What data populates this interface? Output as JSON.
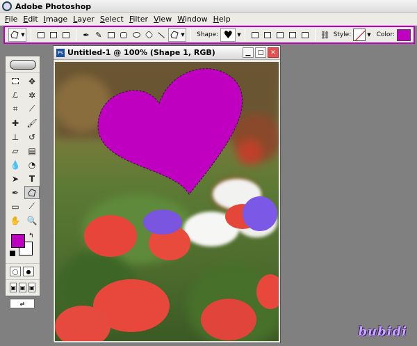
{
  "app": {
    "title": "Adobe Photoshop"
  },
  "menu": [
    "File",
    "Edit",
    "Image",
    "Layer",
    "Select",
    "Filter",
    "View",
    "Window",
    "Help"
  ],
  "options": {
    "shape_label": "Shape:",
    "style_label": "Style:",
    "color_label": "Color:",
    "shape_value": "♥",
    "color_value": "#c000c0"
  },
  "document": {
    "title": "Untitled-1 @ 100% (Shape 1, RGB)",
    "shape_fill": "#c000c0"
  },
  "toolbox": {
    "foreground_color": "#c000c0",
    "background_color": "#ffffff"
  },
  "watermark": "bubidi"
}
